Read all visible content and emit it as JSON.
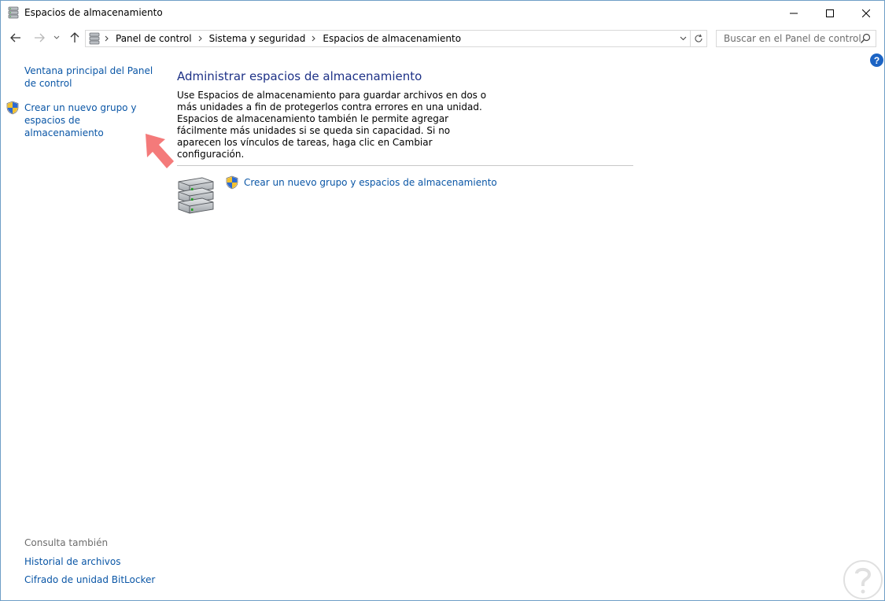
{
  "window": {
    "title": "Espacios de almacenamiento",
    "icon": "storage-spaces-icon"
  },
  "titlebar_controls": {
    "minimize_icon": "minimize-icon",
    "maximize_icon": "maximize-icon",
    "close_icon": "close-icon"
  },
  "navigation": {
    "back_icon": "arrow-left-icon",
    "forward_icon": "arrow-right-icon",
    "recent_icon": "chevron-down-icon",
    "up_icon": "arrow-up-icon"
  },
  "address": {
    "breadcrumbs": [
      "Panel de control",
      "Sistema y seguridad",
      "Espacios de almacenamiento"
    ],
    "dropdown_icon": "chevron-down-icon",
    "refresh_icon": "refresh-icon"
  },
  "search": {
    "placeholder": "Buscar en el Panel de control",
    "icon": "search-icon"
  },
  "help": {
    "label": "?"
  },
  "sidebar": {
    "home_link": "Ventana principal del Panel de control",
    "create_link": "Crear un nuevo grupo y espacios de almacenamiento",
    "see_also_heading": "Consulta también",
    "see_also_links": [
      "Historial de archivos",
      "Cifrado de unidad BitLocker"
    ]
  },
  "main": {
    "title": "Administrar espacios de almacenamiento",
    "description": "Use Espacios de almacenamiento para guardar archivos en dos o más unidades a fin de protegerlos contra errores en una unidad. Espacios de almacenamiento también le permite agregar fácilmente más unidades si se queda sin capacidad. Si no aparecen los vínculos de tareas, haga clic en Cambiar configuración.",
    "task_link": "Crear un nuevo grupo y espacios de almacenamiento"
  },
  "colors": {
    "link": "#0a56a6",
    "heading": "#1e3287",
    "annotation_arrow": "#f47a7a"
  }
}
